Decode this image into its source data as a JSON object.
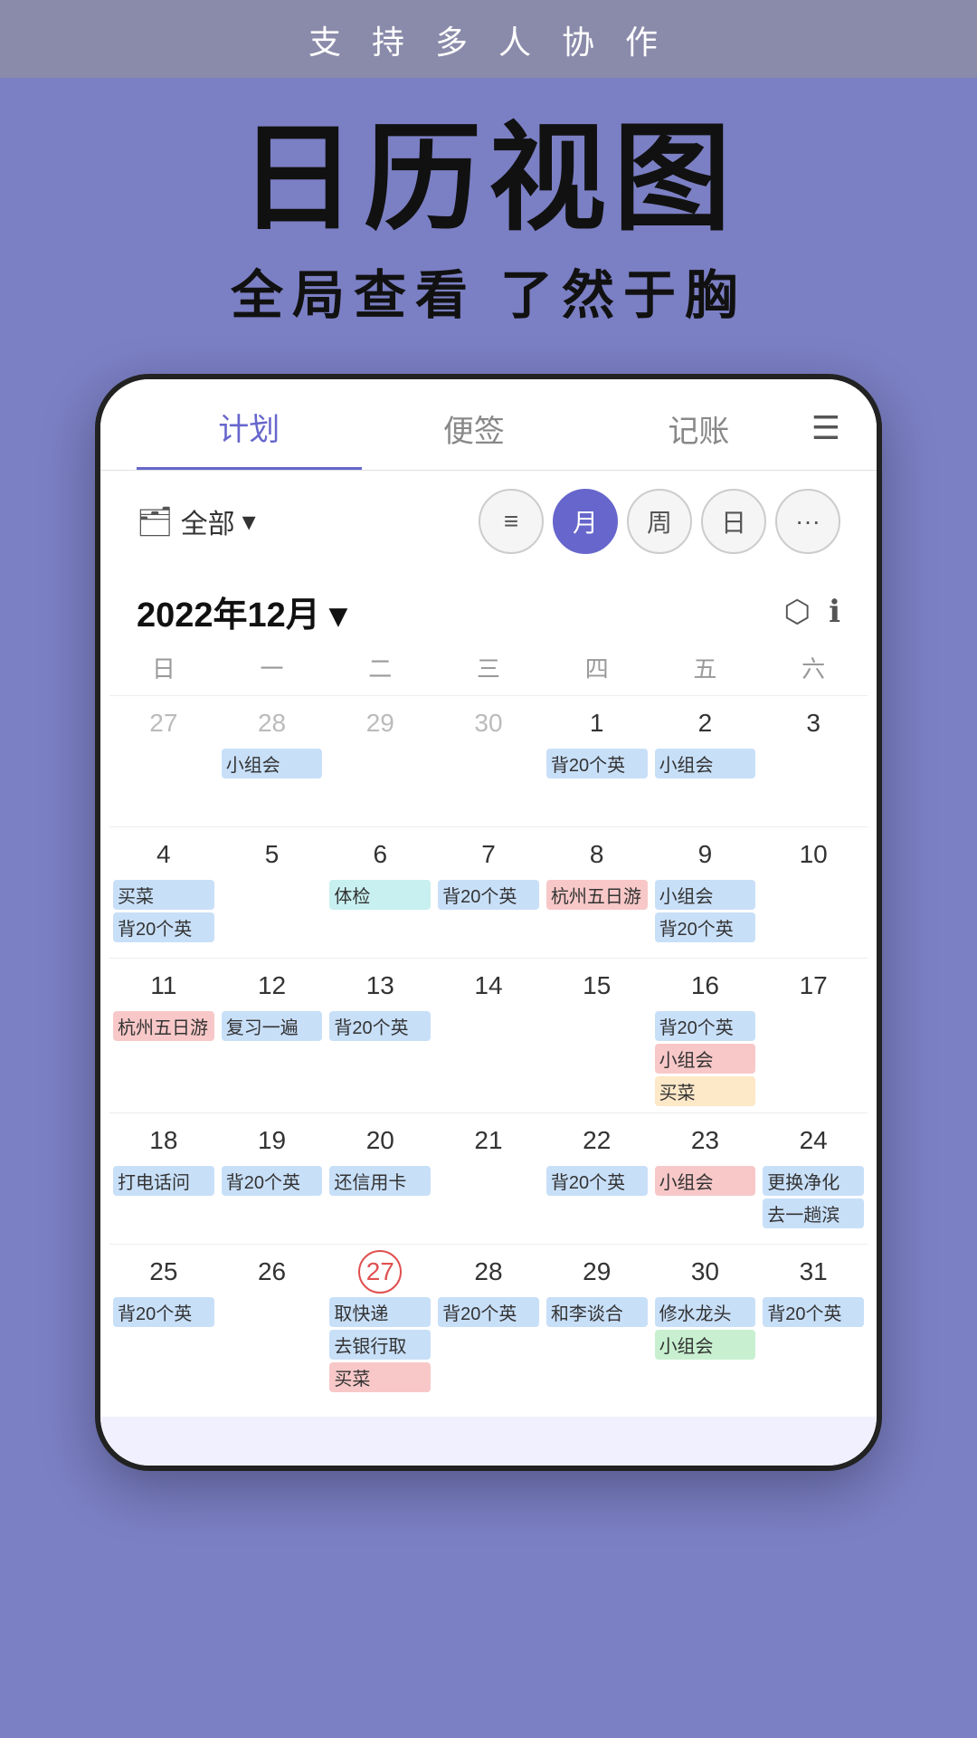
{
  "banner": {
    "text": "支 持 多 人 协 作"
  },
  "hero": {
    "title": "日历视图",
    "subtitle": "全局查看 了然于胸"
  },
  "tabs": [
    {
      "label": "计划",
      "active": true
    },
    {
      "label": "便签",
      "active": false
    },
    {
      "label": "记账",
      "active": false
    }
  ],
  "toolbar": {
    "folder_label": "全部",
    "views": [
      "≡",
      "月",
      "周",
      "日",
      "···"
    ]
  },
  "calendar": {
    "month_title": "2022年12月 ▾",
    "weekdays": [
      "日",
      "一",
      "二",
      "三",
      "四",
      "五",
      "六"
    ],
    "action_export": "⎋",
    "action_info": "ⓘ"
  },
  "days": [
    {
      "num": "27",
      "other": true,
      "events": []
    },
    {
      "num": "28",
      "other": true,
      "events": [
        {
          "text": "小组会",
          "color": "blue"
        }
      ]
    },
    {
      "num": "29",
      "other": true,
      "events": []
    },
    {
      "num": "30",
      "other": true,
      "events": []
    },
    {
      "num": "1",
      "events": [
        {
          "text": "背20个英",
          "color": "blue"
        }
      ]
    },
    {
      "num": "2",
      "events": [
        {
          "text": "小组会",
          "color": "blue"
        }
      ]
    },
    {
      "num": "3",
      "events": []
    },
    {
      "num": "4",
      "events": [
        {
          "text": "买菜",
          "color": "blue"
        },
        {
          "text": "背20个英",
          "color": "blue"
        }
      ]
    },
    {
      "num": "5",
      "events": []
    },
    {
      "num": "6",
      "events": [
        {
          "text": "体检",
          "color": "teal"
        }
      ]
    },
    {
      "num": "7",
      "events": [
        {
          "text": "背20个英",
          "color": "blue"
        }
      ]
    },
    {
      "num": "8",
      "events": [
        {
          "text": "杭州五日游",
          "color": "pink",
          "span": true
        }
      ]
    },
    {
      "num": "9",
      "events": [
        {
          "text": "小组会",
          "color": "blue"
        },
        {
          "text": "背20个英",
          "color": "blue"
        }
      ]
    },
    {
      "num": "10",
      "events": []
    },
    {
      "num": "11",
      "events": [
        {
          "text": "杭州五日游",
          "color": "pink",
          "span": true
        }
      ]
    },
    {
      "num": "12",
      "events": [
        {
          "text": "复习一遍",
          "color": "blue"
        }
      ]
    },
    {
      "num": "13",
      "events": [
        {
          "text": "背20个英",
          "color": "blue"
        }
      ]
    },
    {
      "num": "14",
      "events": []
    },
    {
      "num": "15",
      "events": []
    },
    {
      "num": "16",
      "events": [
        {
          "text": "背20个英",
          "color": "blue"
        },
        {
          "text": "小组会",
          "color": "pink"
        },
        {
          "text": "买菜",
          "color": "orange"
        }
      ]
    },
    {
      "num": "17",
      "events": []
    },
    {
      "num": "18",
      "events": [
        {
          "text": "打电话问",
          "color": "blue"
        }
      ]
    },
    {
      "num": "19",
      "events": [
        {
          "text": "背20个英",
          "color": "blue"
        }
      ]
    },
    {
      "num": "20",
      "events": [
        {
          "text": "还信用卡",
          "color": "blue"
        }
      ]
    },
    {
      "num": "21",
      "events": []
    },
    {
      "num": "22",
      "events": [
        {
          "text": "背20个英",
          "color": "blue"
        }
      ]
    },
    {
      "num": "23",
      "events": [
        {
          "text": "小组会",
          "color": "pink"
        }
      ]
    },
    {
      "num": "24",
      "events": [
        {
          "text": "更换净化",
          "color": "blue"
        },
        {
          "text": "去一趟滨",
          "color": "blue"
        }
      ]
    },
    {
      "num": "25",
      "events": [
        {
          "text": "背20个英",
          "color": "blue"
        }
      ]
    },
    {
      "num": "26",
      "events": []
    },
    {
      "num": "27",
      "today": true,
      "events": [
        {
          "text": "取快递",
          "color": "blue"
        },
        {
          "text": "去银行取",
          "color": "blue"
        },
        {
          "text": "买菜",
          "color": "pink"
        }
      ]
    },
    {
      "num": "28",
      "events": [
        {
          "text": "背20个英",
          "color": "blue"
        }
      ]
    },
    {
      "num": "29",
      "events": [
        {
          "text": "和李谈合",
          "color": "blue"
        }
      ]
    },
    {
      "num": "30",
      "events": [
        {
          "text": "修水龙头",
          "color": "blue"
        },
        {
          "text": "小组会",
          "color": "green"
        }
      ]
    },
    {
      "num": "31",
      "events": [
        {
          "text": "背20个英",
          "color": "blue"
        }
      ]
    }
  ]
}
